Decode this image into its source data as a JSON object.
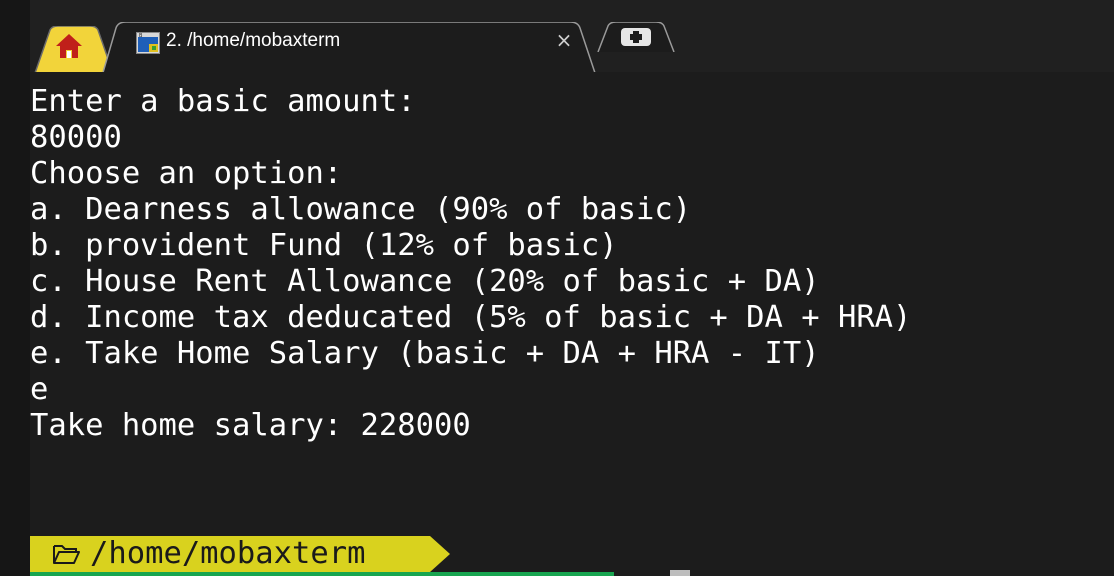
{
  "tabs": {
    "home": {
      "icon": "home-icon"
    },
    "session": {
      "icon": "terminal-icon",
      "title": "2. /home/mobaxterm",
      "close_glyph": "×"
    },
    "new_tab": {
      "icon": "plus-icon"
    }
  },
  "terminal": {
    "lines": [
      "Enter a basic amount:",
      "80000",
      "Choose an option:",
      "a. Dearness allowance (90% of basic)",
      "b. provident Fund (12% of basic)",
      "c. House Rent Allowance (20% of basic + DA)",
      "d. Income tax deducated (5% of basic + DA + HRA)",
      "e. Take Home Salary (basic + DA + HRA - IT)",
      "e",
      "Take home salary: 228000"
    ]
  },
  "prompt": {
    "icon": "folder-icon",
    "path": "/home/mobaxterm"
  },
  "colors": {
    "background": "#1c1c1c",
    "text": "#ffffff",
    "prompt_bg": "#d9d21e",
    "prompt_underline": "#18a550",
    "home_tab_bg": "#f2d43a",
    "home_icon": "#c0201a"
  }
}
